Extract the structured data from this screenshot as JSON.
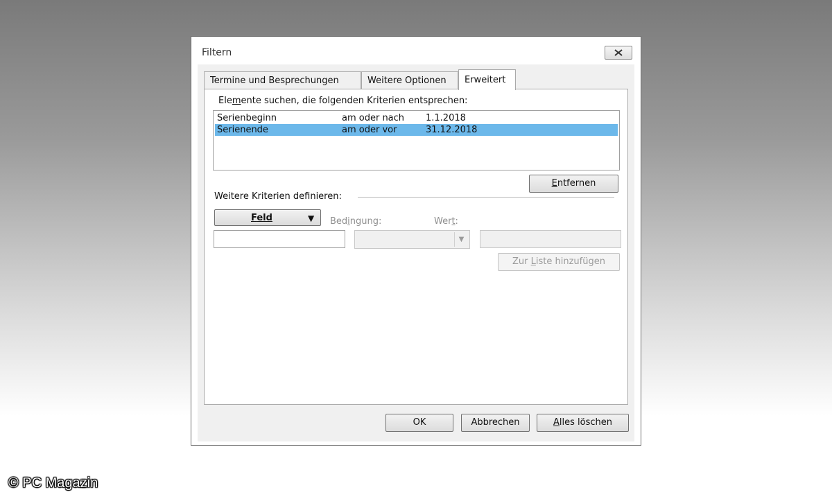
{
  "window": {
    "title": "Filtern"
  },
  "tabs": [
    {
      "label": "Termine und Besprechungen",
      "active": false
    },
    {
      "label": "Weitere Optionen",
      "active": false
    },
    {
      "label": "Erweitert",
      "active": true
    }
  ],
  "criteria": {
    "heading_pre": "Ele",
    "heading_accel": "m",
    "heading_post": "ente suchen, die folgenden Kriterien entsprechen:",
    "rows": [
      {
        "field": "Serienbeginn",
        "condition": "am oder nach",
        "value": "1.1.2018",
        "selected": false
      },
      {
        "field": "Serienende",
        "condition": "am oder vor",
        "value": "31.12.2018",
        "selected": true
      }
    ],
    "remove_accel": "E",
    "remove_rest": "ntfernen"
  },
  "define": {
    "heading": "Weitere Kriterien definieren:",
    "field_button_accel": "F",
    "field_button_rest": "eld",
    "condition_pre": "Bed",
    "condition_accel": "i",
    "condition_post": "ngung:",
    "value_pre": "Wer",
    "value_accel": "t",
    "value_post": ":",
    "add_pre": "Zur ",
    "add_accel": "L",
    "add_post": "iste hinzufügen"
  },
  "footer": {
    "ok": "OK",
    "cancel": "Abbrechen",
    "clear_accel": "A",
    "clear_rest": "lles löschen"
  },
  "watermark": "© PC Magazin",
  "colors": {
    "selection": "#6cb8ea",
    "dialog_bg": "#f0f0f0"
  }
}
